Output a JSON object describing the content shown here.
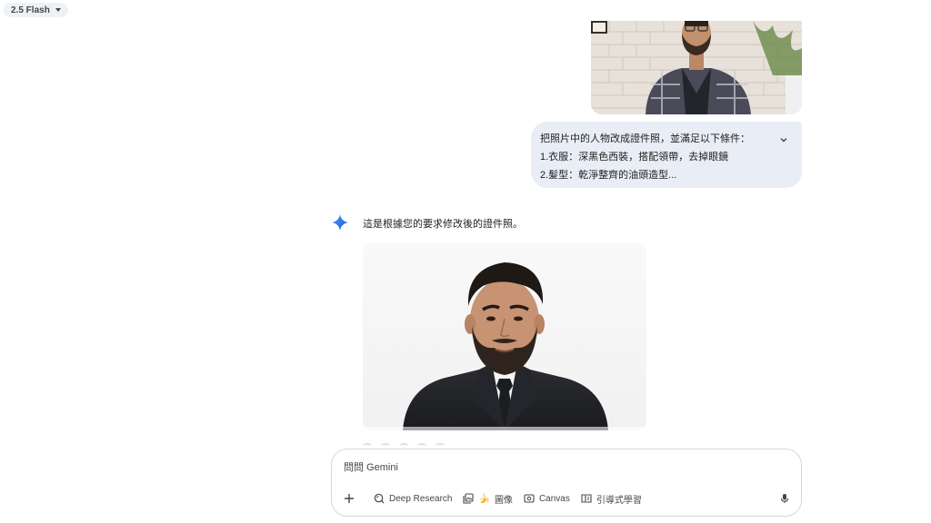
{
  "header": {
    "model_label": "2.5 Flash"
  },
  "conversation": {
    "user_prompt_lines": [
      "把照片中的人物改成證件照，並滿足以下條件：",
      "1.衣服：深黑色西裝，搭配領帶，去掉眼鏡",
      "2.髮型：乾淨整齊的油頭造型..."
    ],
    "response_text": "這是根據您的要求修改後的證件照。"
  },
  "composer": {
    "placeholder": "問問 Gemini",
    "tools": {
      "deep_research": "Deep Research",
      "image": "圖像",
      "image_emoji": "🍌",
      "canvas": "Canvas",
      "guided_learning": "引導式學習"
    }
  },
  "colors": {
    "accent_blue": "#4285f4",
    "bubble_bg": "#e9eef6",
    "chip_bg": "#eef1f6"
  }
}
